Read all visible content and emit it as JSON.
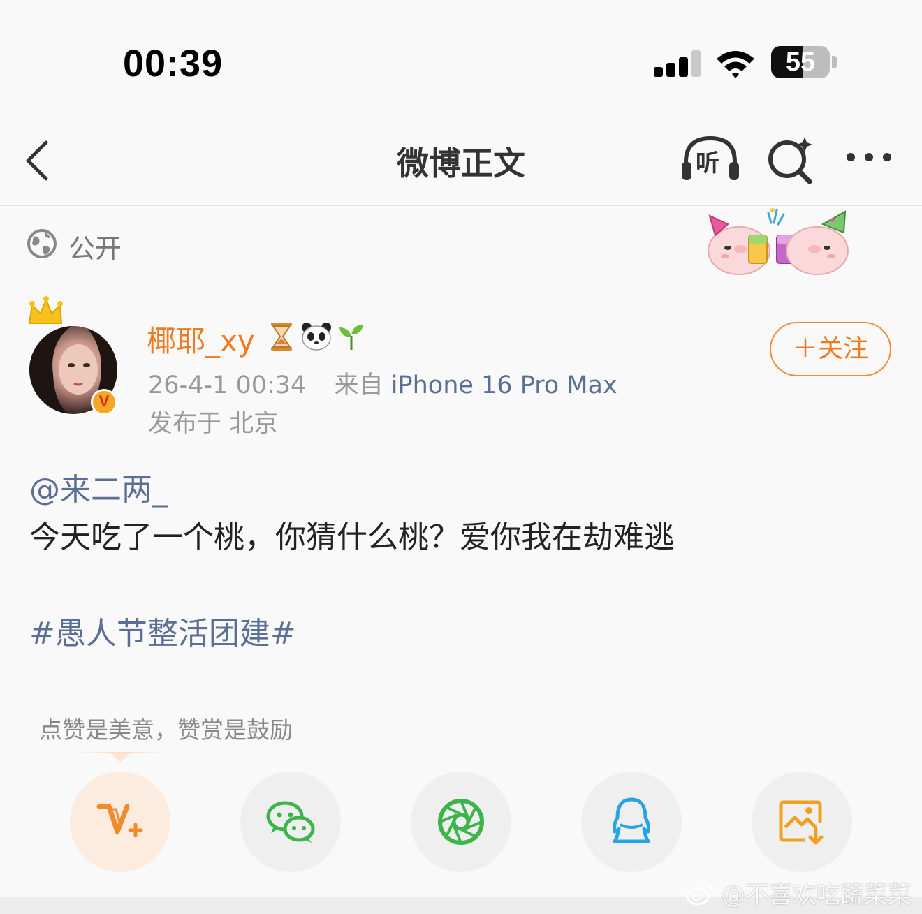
{
  "status_bar": {
    "time": "00:39",
    "battery_level": "55"
  },
  "nav": {
    "title": "微博正文",
    "listen_label": "听"
  },
  "visibility": {
    "label": "公开"
  },
  "post": {
    "author": {
      "name": "椰耶_xy",
      "emojis": [
        "hourglass-emoji",
        "panda-emoji",
        "seedling-emoji"
      ],
      "verified": true
    },
    "date": "26-4-1 00:34",
    "source_prefix": "来自",
    "device": "iPhone 16 Pro Max",
    "location": "发布于 北京",
    "follow_label": "＋关注",
    "mention": "@来二两_",
    "text": "今天吃了一个桃，你猜什么桃？爱你我在劫难逃",
    "hashtag": "#愚人节整活团建#"
  },
  "reward_tip": "点赞是美意，赞赏是鼓励",
  "share_actions": [
    {
      "name": "reward-v-plus-icon",
      "color": "#f08a2a"
    },
    {
      "name": "wechat-icon",
      "color": "#3bb54a"
    },
    {
      "name": "moments-icon",
      "color": "#3bb54a"
    },
    {
      "name": "qq-icon",
      "color": "#2aa3e6"
    },
    {
      "name": "save-image-icon",
      "color": "#f0a020"
    }
  ],
  "watermark": "@不喜欢吃蔬菜菜"
}
